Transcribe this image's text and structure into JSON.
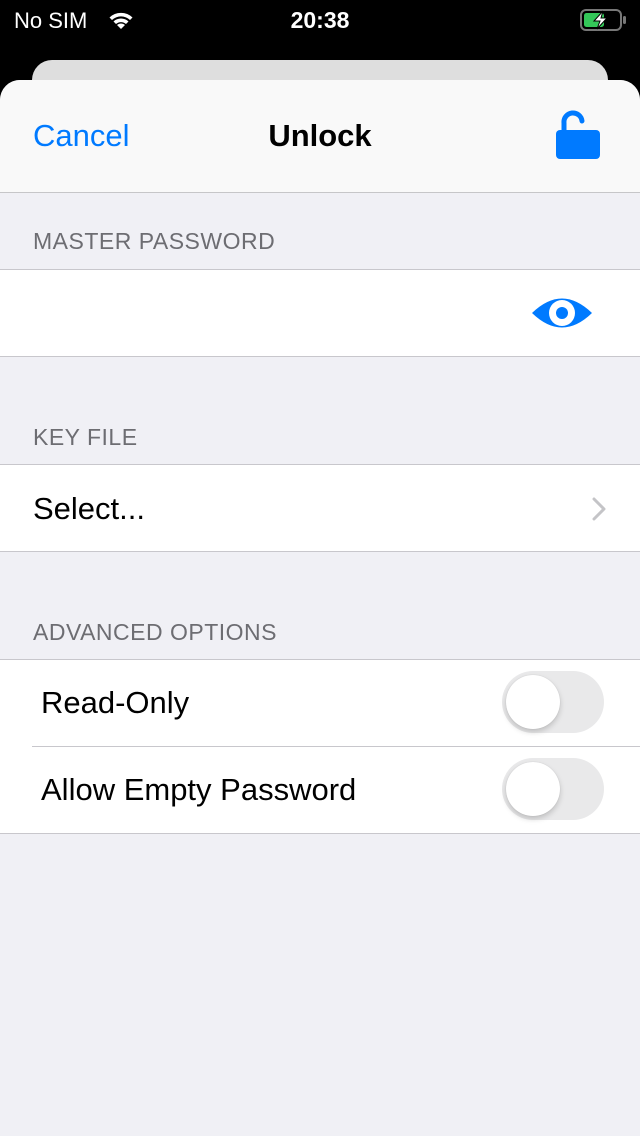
{
  "status_bar": {
    "carrier": "No SIM",
    "time": "20:38",
    "battery_state": "charging"
  },
  "nav": {
    "cancel_label": "Cancel",
    "title": "Unlock",
    "unlock_icon": "lock-open-icon"
  },
  "sections": {
    "master_password": {
      "header": "MASTER PASSWORD",
      "value": "",
      "reveal_icon": "eye-icon"
    },
    "key_file": {
      "header": "KEY FILE",
      "select_label": "Select..."
    },
    "advanced": {
      "header": "ADVANCED OPTIONS",
      "options": [
        {
          "label": "Read-Only",
          "enabled": false
        },
        {
          "label": "Allow Empty Password",
          "enabled": false
        }
      ]
    }
  },
  "colors": {
    "accent": "#007aff",
    "battery": "#34c759"
  }
}
